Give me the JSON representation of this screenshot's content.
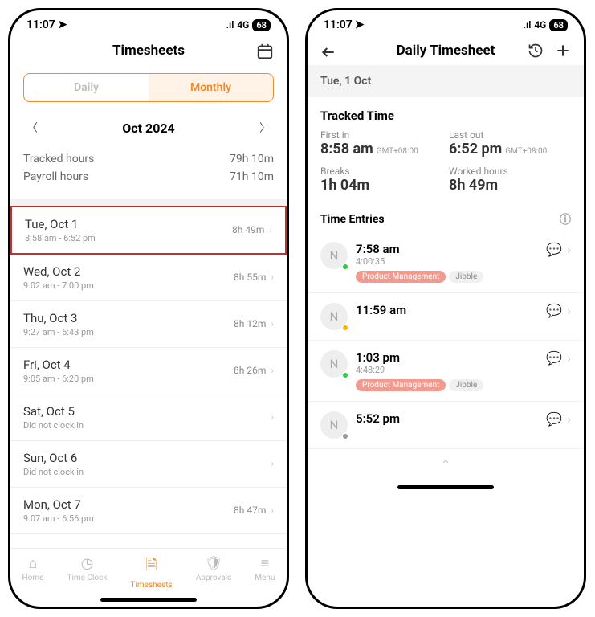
{
  "status": {
    "time": "11:07",
    "network": "4G",
    "battery": "68"
  },
  "screen1": {
    "title": "Timesheets",
    "segments": {
      "daily": "Daily",
      "monthly": "Monthly"
    },
    "monthLabel": "Oct 2024",
    "summary": {
      "trackedLabel": "Tracked hours",
      "trackedVal": "79h 10m",
      "payrollLabel": "Payroll hours",
      "payrollVal": "71h 10m"
    },
    "days": [
      {
        "title": "Tue, Oct 1",
        "sub": "8:58 am - 6:52 pm",
        "dur": "8h 49m",
        "highlight": true
      },
      {
        "title": "Wed, Oct 2",
        "sub": "9:02 am - 7:00 pm",
        "dur": "8h 55m"
      },
      {
        "title": "Thu, Oct 3",
        "sub": "9:27 am - 6:43 pm",
        "dur": "8h 12m"
      },
      {
        "title": "Fri, Oct 4",
        "sub": "9:05 am - 6:20 pm",
        "dur": "8h 26m"
      },
      {
        "title": "Sat, Oct 5",
        "sub": "Did not clock in",
        "dur": ""
      },
      {
        "title": "Sun, Oct 6",
        "sub": "Did not clock in",
        "dur": ""
      },
      {
        "title": "Mon, Oct 7",
        "sub": "9:07 am - 6:56 pm",
        "dur": "8h 47m"
      }
    ],
    "tabs": {
      "home": "Home",
      "clock": "Time Clock",
      "sheets": "Timesheets",
      "approvals": "Approvals",
      "menu": "Menu"
    }
  },
  "screen2": {
    "title": "Daily Timesheet",
    "dateBanner": "Tue, 1 Oct",
    "trackedTitle": "Tracked Time",
    "firstInLabel": "First in",
    "firstInVal": "8:58 am",
    "tz": "GMT+08:00",
    "lastOutLabel": "Last out",
    "lastOutVal": "6:52 pm",
    "breaksLabel": "Breaks",
    "breaksVal": "1h 04m",
    "workedLabel": "Worked hours",
    "workedVal": "8h 49m",
    "entriesTitle": "Time Entries",
    "entries": [
      {
        "avatar": "N",
        "dot": "green",
        "time": "7:58 am",
        "dur": "4:00:35",
        "pills": [
          "Product Management",
          "Jibble"
        ]
      },
      {
        "avatar": "N",
        "dot": "orange",
        "time": "11:59 am",
        "dur": "",
        "pills": []
      },
      {
        "avatar": "N",
        "dot": "green",
        "time": "1:03 pm",
        "dur": "4:48:29",
        "pills": [
          "Product Management",
          "Jibble"
        ]
      },
      {
        "avatar": "N",
        "dot": "grey",
        "time": "5:52 pm",
        "dur": "",
        "pills": []
      }
    ]
  }
}
